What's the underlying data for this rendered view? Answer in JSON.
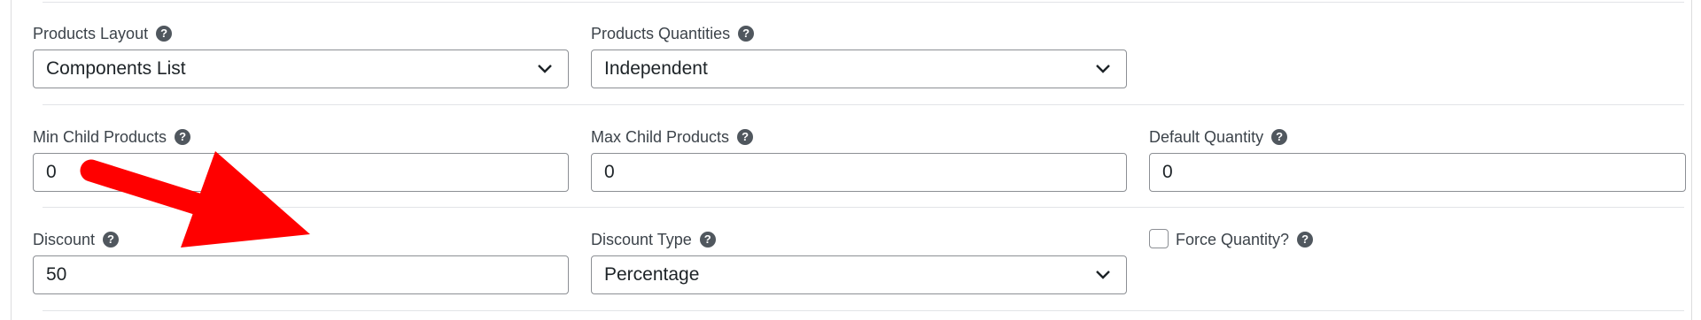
{
  "row1": {
    "products_layout": {
      "label": "Products Layout",
      "value": "Components List"
    },
    "products_quantities": {
      "label": "Products Quantities",
      "value": "Independent"
    }
  },
  "row2": {
    "min_child": {
      "label": "Min Child Products",
      "value": "0"
    },
    "max_child": {
      "label": "Max Child Products",
      "value": "0"
    },
    "default_qty": {
      "label": "Default Quantity",
      "value": "0"
    }
  },
  "row3": {
    "discount": {
      "label": "Discount",
      "value": "50"
    },
    "discount_type": {
      "label": "Discount Type",
      "value": "Percentage"
    },
    "force_qty": {
      "label": "Force Quantity?",
      "checked": false
    }
  },
  "help_glyph": "?",
  "icons": {
    "help": "help-icon",
    "dropdown": "chevron-down-icon",
    "annotation": "red-arrow-annotation"
  },
  "colors": {
    "annotation_arrow": "#ff0000",
    "help_icon": "#50575e",
    "border": "#8c8f94"
  }
}
